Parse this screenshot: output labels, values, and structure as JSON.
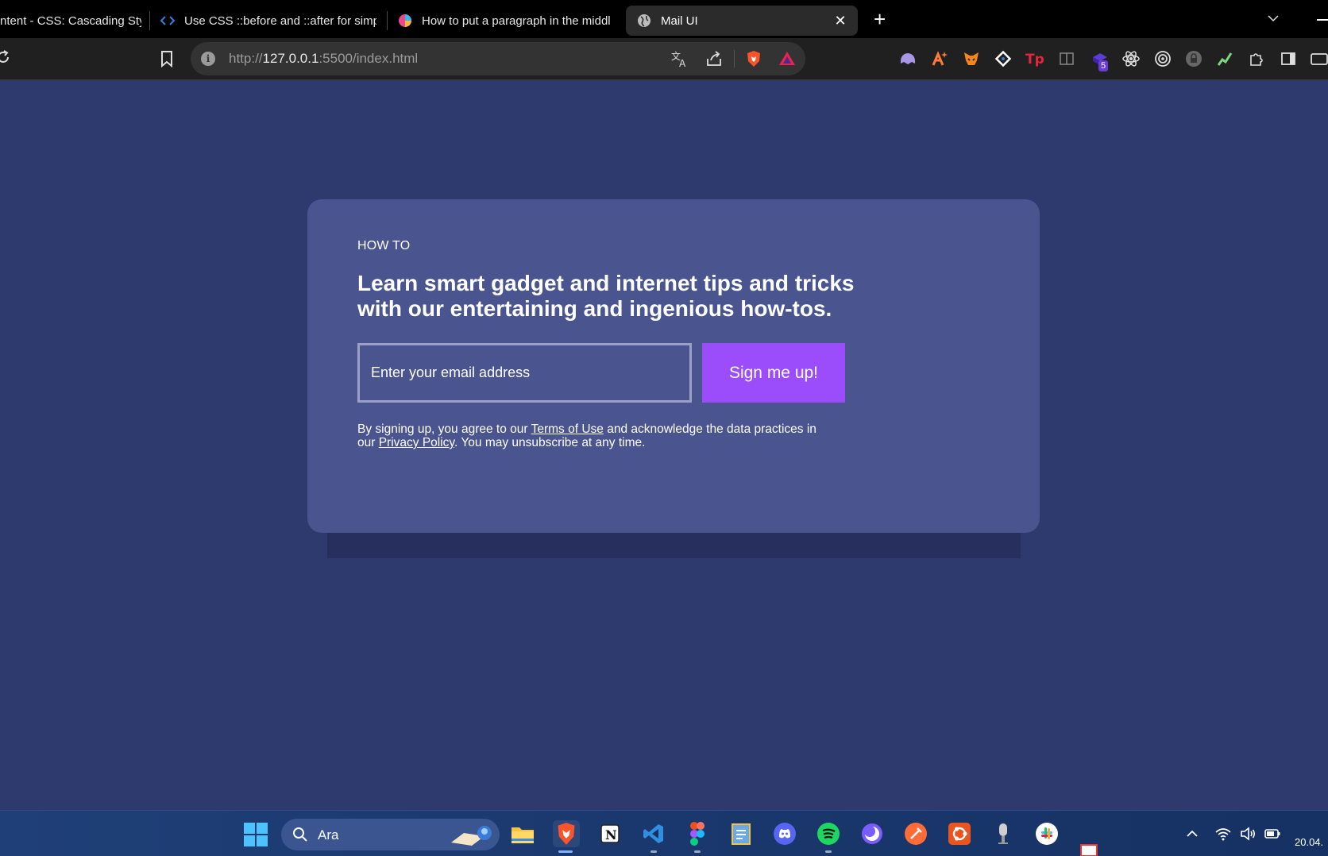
{
  "browser": {
    "tabs": [
      {
        "title": "ntent - CSS: Cascading Styl"
      },
      {
        "title": "Use CSS ::before and ::after for simpl"
      },
      {
        "title": "How to put a paragraph in the middl"
      },
      {
        "title": "Mail UI",
        "active": true
      }
    ],
    "new_tab_label": "+",
    "close_label": "✕",
    "url_prefix": "http://",
    "url_host": "127.0.0.1",
    "url_rest": ":5500/index.html",
    "extension_badge": "5"
  },
  "page": {
    "eyebrow": "HOW TO",
    "headline": "Learn smart gadget and internet tips and tricks with our entertaining and ingenious how-tos.",
    "email_placeholder": "Enter your email address",
    "signup_label": "Sign me up!",
    "legal_prefix": "By signing up, you agree to our ",
    "terms_link": "Terms of Use",
    "legal_middle": " and acknowledge the data practices in our ",
    "privacy_link": "Privacy Policy",
    "legal_suffix": ". You may unsubscribe at any time."
  },
  "taskbar": {
    "search_label": "Ara",
    "clock_date": "20.04."
  },
  "colors": {
    "page_bg": "#2e3a6e",
    "card_bg": "#4a548f",
    "button_bg": "#9b4dfb"
  }
}
